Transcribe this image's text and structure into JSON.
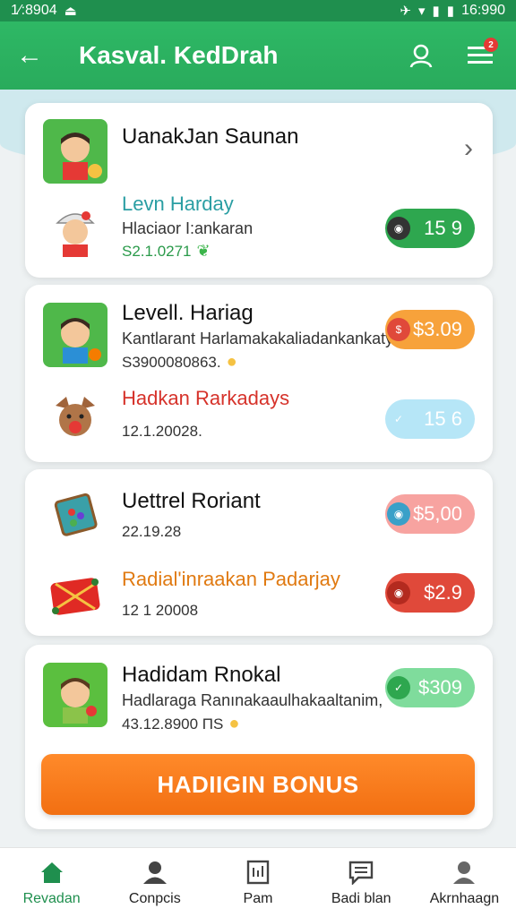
{
  "status_bar": {
    "time": "1⁄:8904",
    "clock": "16:990"
  },
  "header": {
    "title": "Kasval. KedDrah",
    "notification_count": "2"
  },
  "cards": [
    {
      "rows": [
        {
          "title": "UanakJan Saunan"
        },
        {
          "title": "Levn Harday",
          "subtitle": "Hlaciaor I:ankaran",
          "meta": "S2.1.0271",
          "amount": "15 9"
        }
      ]
    },
    {
      "rows": [
        {
          "title": "Levell. Hariag",
          "subtitle": "Kantlarant Harlamakakaliadankankaty",
          "meta": "S3900080863.",
          "amount": "$3.09"
        },
        {
          "title": "Hadkan Rarkadays",
          "meta": "12.1.20028.",
          "amount": "15 6"
        }
      ]
    },
    {
      "rows": [
        {
          "title": "Uettrel Roriant",
          "meta": "22.19.28",
          "amount": "$5,00"
        },
        {
          "title": "Radial'inraakan Padarjay",
          "meta": "12 1 20008",
          "amount": "$2.9"
        }
      ]
    },
    {
      "rows": [
        {
          "title": "Hadidam Rnokal",
          "subtitle": "Hadlaraga Ranınakaaulhakaaltanim,",
          "meta": "43.12.8900 ПЅ",
          "amount": "$309"
        }
      ]
    }
  ],
  "bonus_button": "HADIIGIN BONUS",
  "nav": [
    {
      "label": "Revadan",
      "icon": "home-icon"
    },
    {
      "label": "Conpcis",
      "icon": "person-icon"
    },
    {
      "label": "Pam",
      "icon": "document-icon"
    },
    {
      "label": "Badi blan",
      "icon": "chat-icon"
    },
    {
      "label": "Akrnhaagn",
      "icon": "profile-icon"
    }
  ],
  "colors": {
    "primary": "#2eb865",
    "orange": "#f7a23b",
    "red": "#e0493a",
    "pink": "#f7a3a0",
    "light_blue": "#b6e6f7",
    "light_green": "#7fdc9c",
    "bonus": "#f26f12"
  }
}
